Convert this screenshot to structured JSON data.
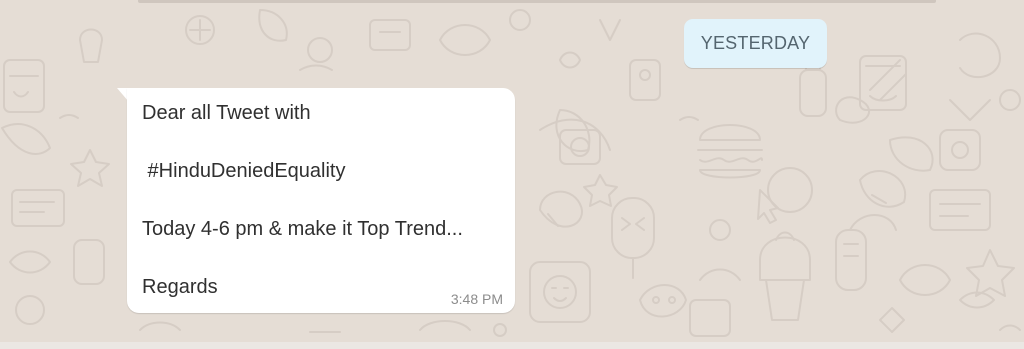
{
  "conversation": {
    "date_separator": "YESTERDAY",
    "messages": [
      {
        "direction": "incoming",
        "lines": [
          "Dear all Tweet with",
          " #HinduDeniedEquality",
          "Today 4-6 pm & make it Top Trend...",
          "Regards"
        ],
        "time": "3:48 PM"
      }
    ]
  },
  "theme": {
    "wallpaper_color": "#e5ddd5",
    "doodle_color": "#d8cfc7",
    "incoming_bubble_color": "#ffffff",
    "date_chip_color": "#e1f3fb"
  }
}
